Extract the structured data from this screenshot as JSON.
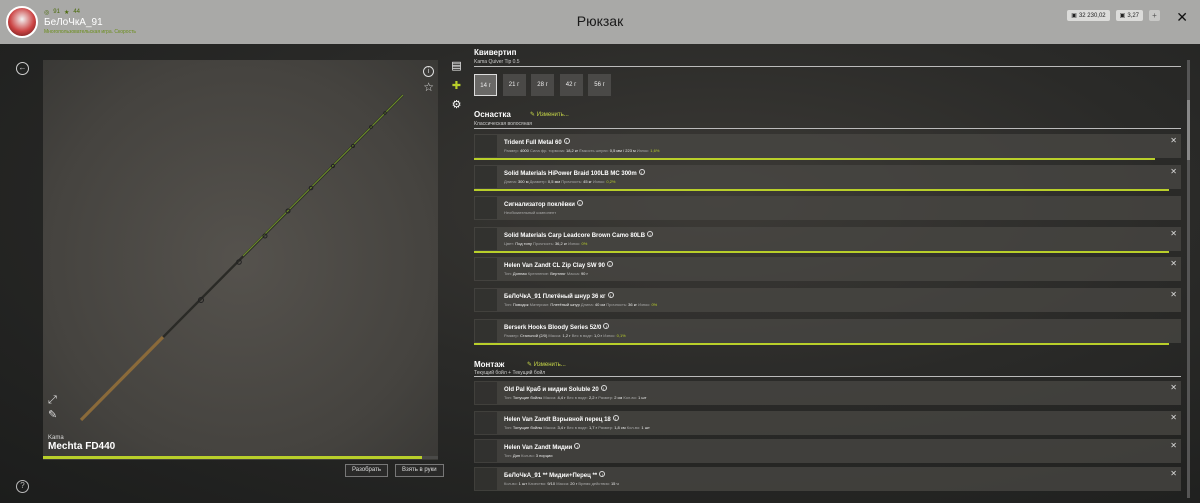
{
  "header": {
    "title": "Рюкзак",
    "user": {
      "level": "91",
      "rating": "44",
      "name": "БеЛоЧкА_91",
      "status": "Многопользовательская игра. Скорость"
    },
    "wallet": {
      "silver": "32 230,02",
      "gold": "3,27",
      "plus": "+"
    },
    "close": "✕"
  },
  "left_panel": {
    "rod_brand": "Kama",
    "rod_name": "Mechta FD440",
    "rod_condition": 0.96,
    "buttons": {
      "disassemble": "Разобрать",
      "take_in_hands": "Взять в руки"
    }
  },
  "tips": {
    "title": "Квивертип",
    "subtitle": "Kama Quiver Tip 0.5",
    "options": [
      "14 г",
      "21 г",
      "28 г",
      "42 г",
      "56 г"
    ],
    "selected": 0
  },
  "tackle": {
    "title": "Оснастка",
    "edit_label": "Изменить...",
    "subtitle": "Классическая волосяная",
    "items": [
      {
        "name": "Trident Full Metal 60",
        "meta": [
          [
            "Размер:",
            "4000"
          ],
          [
            "Сила фр. тормоза:",
            "18,2 кг"
          ],
          [
            "Ёмкость шпули:",
            "0,5 мм / 223 м"
          ],
          [
            "Износ:",
            "1,6%"
          ]
        ],
        "condition": 0.98,
        "closable": true
      },
      {
        "name": "Solid Materials HiPower Braid 100LB MC 300m",
        "meta": [
          [
            "Длина:",
            "300 м"
          ],
          [
            "Диаметр:",
            "0,5 мм"
          ],
          [
            "Прочность:",
            "45 кг"
          ],
          [
            "Износ:",
            "0,2%"
          ]
        ],
        "condition": 1.0,
        "closable": true
      },
      {
        "name": "Сигнализатор поклёвки",
        "meta": [
          [
            "Необязательный компонент",
            ""
          ]
        ],
        "condition": null,
        "closable": false
      },
      {
        "name": "Solid Materials Carp Leadcore Brown Camo 80LB",
        "meta": [
          [
            "Цвет:",
            "Под тину"
          ],
          [
            "Прочность:",
            "36,2 кг"
          ],
          [
            "Износ:",
            "0%"
          ]
        ],
        "condition": 1.0,
        "closable": true
      },
      {
        "name": "Helen Van Zandt CL Zip Clay SW 90",
        "meta": [
          [
            "Тип:",
            "Донная"
          ],
          [
            "Крепление:",
            "Вертлюг"
          ],
          [
            "Масса:",
            "90 г"
          ]
        ],
        "condition": null,
        "closable": true
      },
      {
        "name": "БеЛоЧкА_91 Плетёный шнур 36 кг",
        "meta": [
          [
            "Тип:",
            "Поводок"
          ],
          [
            "Материал:",
            "Плетёный шнур"
          ],
          [
            "Длина:",
            "40 см"
          ],
          [
            "Прочность:",
            "36 кг"
          ],
          [
            "Износ:",
            "0%"
          ]
        ],
        "condition": null,
        "closable": true
      },
      {
        "name": "Berserk Hooks Bloody Series 52/0",
        "meta": [
          [
            "Размер:",
            "Стальной (2/0)"
          ],
          [
            "Масса:",
            "1,2 г"
          ],
          [
            "Вес в воде:",
            "1,0 г"
          ],
          [
            "Износ:",
            "0,1%"
          ]
        ],
        "condition": 1.0,
        "closable": false
      }
    ]
  },
  "rig": {
    "title": "Монтаж",
    "edit_label": "Изменить...",
    "subtitle": "Текущий бойл + Текущий бойл",
    "items": [
      {
        "name": "Old Pal Краб и мидии Soluble 20",
        "meta": [
          [
            "Тип:",
            "Тонущие бойлы"
          ],
          [
            "Масса:",
            "4,4 г"
          ],
          [
            "Вес в воде:",
            "2,2 г"
          ],
          [
            "Размер:",
            "2 см"
          ],
          [
            "Кол-во:",
            "1 шт"
          ]
        ],
        "closable": true
      },
      {
        "name": "Helen Van Zandt Взрывной перец 18",
        "meta": [
          [
            "Тип:",
            "Тонущие бойлы"
          ],
          [
            "Масса:",
            "3,4 г"
          ],
          [
            "Вес в воде:",
            "1,7 г"
          ],
          [
            "Размер:",
            "1,8 см"
          ],
          [
            "Кол-во:",
            "1 шт"
          ]
        ],
        "closable": true
      },
      {
        "name": "Helen Van Zandt Мидии",
        "meta": [
          [
            "Тип:",
            "Дип"
          ],
          [
            "Кол-во:",
            "3 порции"
          ]
        ],
        "closable": true
      },
      {
        "name": "БеЛоЧкА_91 ** Мидии+Перец **",
        "meta": [
          [
            "Кол-во:",
            "1 шт"
          ],
          [
            "Качество:",
            "9/10"
          ],
          [
            "Масса:",
            "20 г"
          ],
          [
            "Время действия:",
            "15 ч"
          ]
        ],
        "closable": true
      }
    ]
  },
  "colors": {
    "accent": "#b9cf2a",
    "header_bg": "#a9a9a7"
  }
}
